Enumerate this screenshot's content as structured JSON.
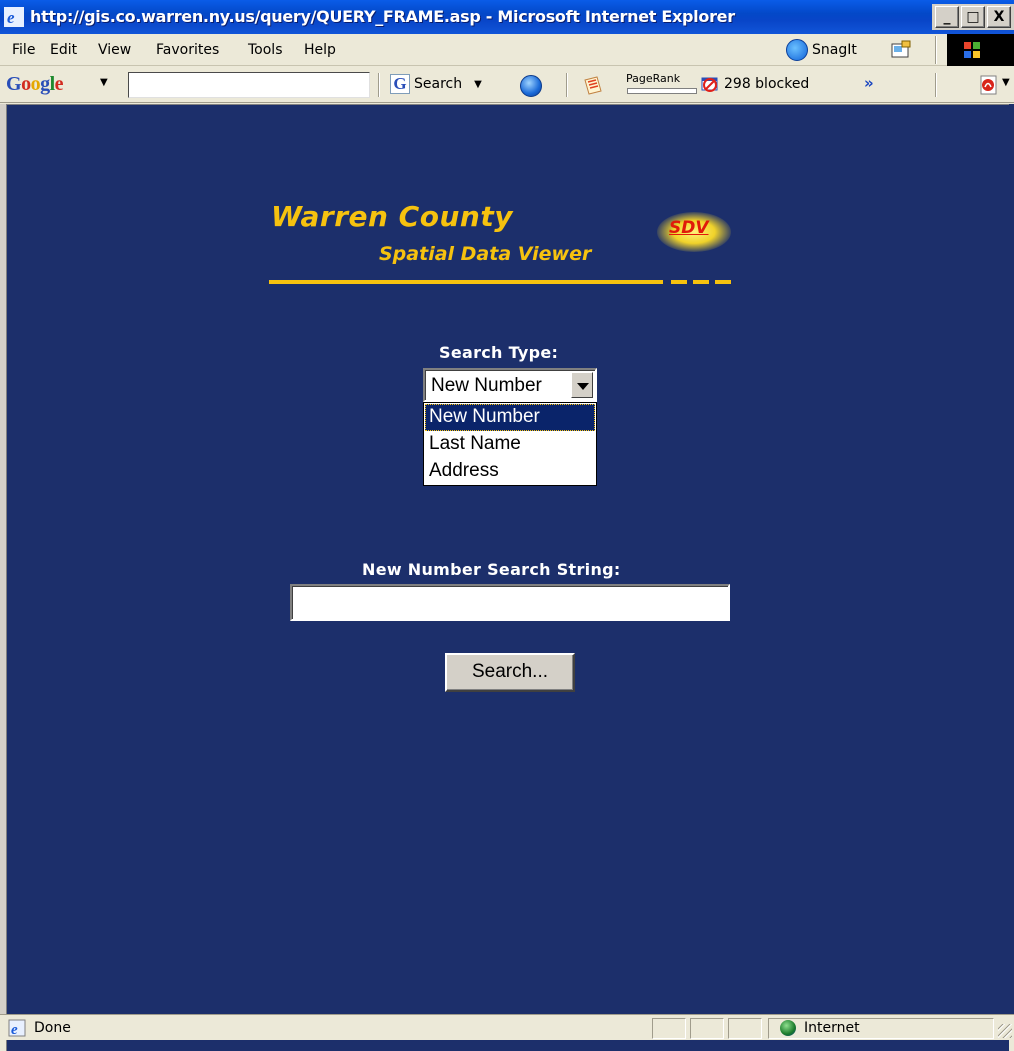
{
  "window": {
    "title": "http://gis.co.warren.ny.us/query/QUERY_FRAME.asp - Microsoft Internet Explorer",
    "buttons": {
      "minimize": "_",
      "maximize": "□",
      "close": "X"
    }
  },
  "menubar": {
    "items": [
      "File",
      "Edit",
      "View",
      "Favorites",
      "Tools",
      "Help"
    ],
    "snagit_label": "SnagIt"
  },
  "google_toolbar": {
    "logo": [
      "G",
      "o",
      "o",
      "g",
      "l",
      "e"
    ],
    "search_value": "",
    "search_label": "Search",
    "pagerank_label": "PageRank",
    "blocked_label": "298 blocked",
    "more": "»"
  },
  "page": {
    "logo": {
      "line1": "Warren County",
      "line2": "Spatial Data Viewer",
      "badge": "SDV"
    },
    "search_type_label": "Search Type:",
    "search_type_selected": "New Number",
    "search_type_options": [
      "New Number",
      "Last Name",
      "Address"
    ],
    "search_string_label": "New Number Search String:",
    "search_string_value": "",
    "search_button": "Search..."
  },
  "statusbar": {
    "status": "Done",
    "zone": "Internet"
  },
  "colors": {
    "page_bg": "#1c2f6b",
    "logo_yellow": "#f6c20f",
    "badge_red": "#e01a0a",
    "selection": "#0a246a",
    "titlebar": "#0348c8"
  }
}
